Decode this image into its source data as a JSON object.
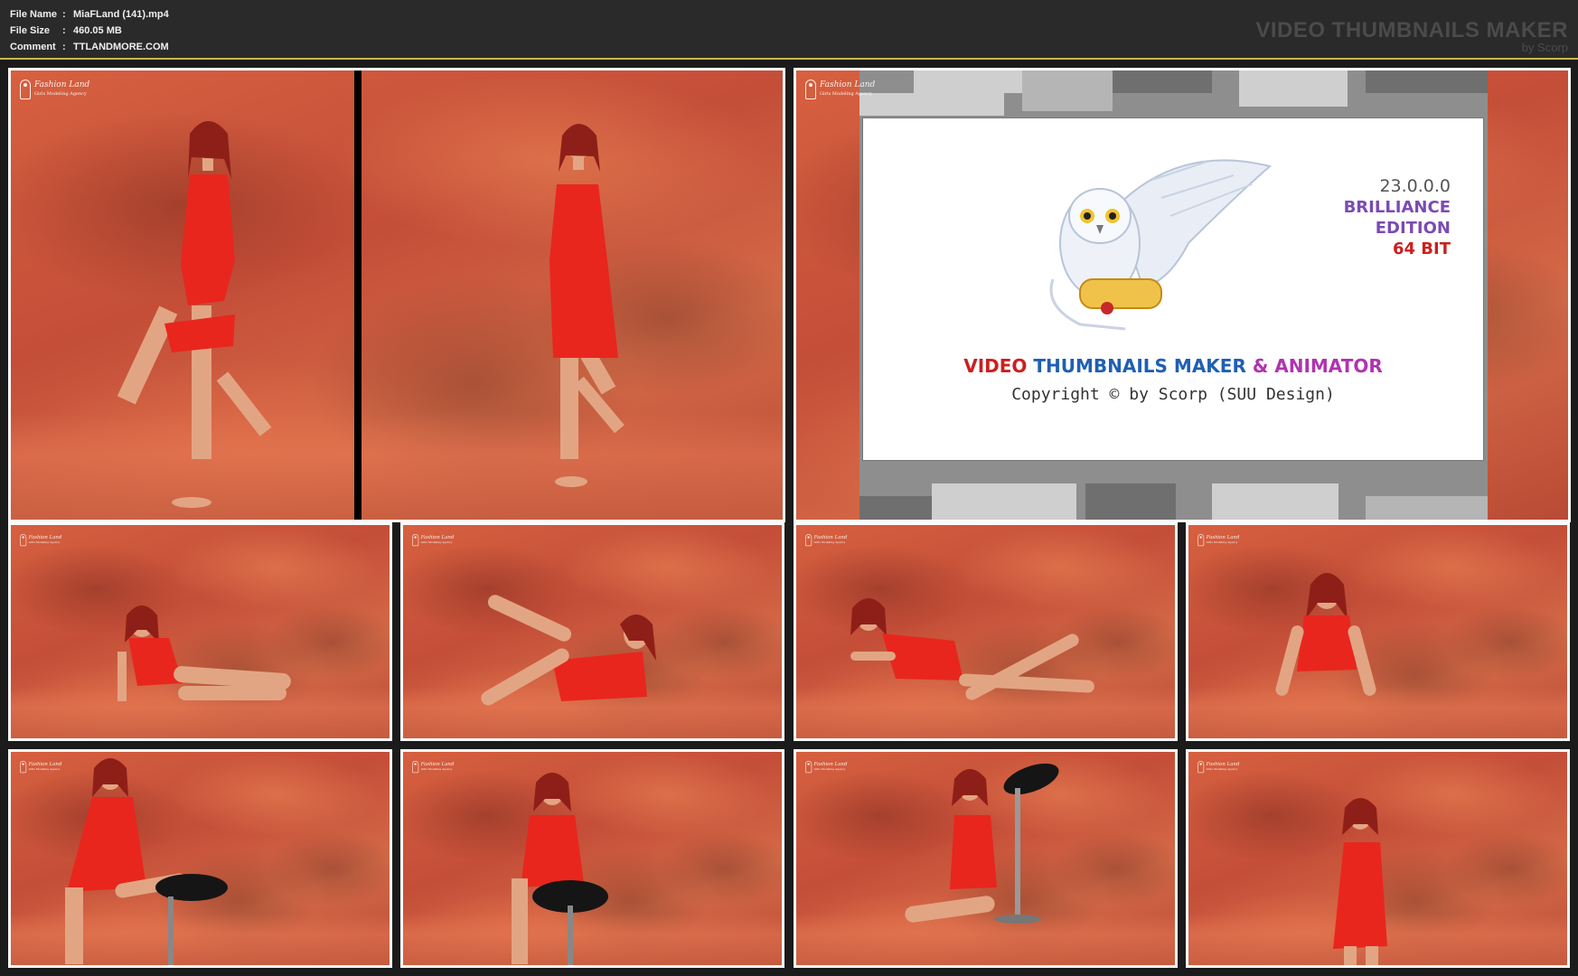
{
  "meta": {
    "rows": [
      {
        "key": "File Name",
        "sep": ":",
        "value": "MiaFLand (141).mp4"
      },
      {
        "key": "File Size",
        "sep": ":",
        "value": "460.05 MB"
      },
      {
        "key": "Comment",
        "sep": ":",
        "value": "TTLANDMORE.COM"
      }
    ]
  },
  "brand": {
    "title": "VIDEO THUMBNAILS MAKER",
    "subtitle": "by Scorp"
  },
  "splash": {
    "version": "23.0.0.0",
    "edition_line1": "BRILLIANCE",
    "edition_line2": "EDITION",
    "bits": "64 BIT",
    "product_part1": "VIDEO ",
    "product_part2": "THUMBNAILS MAKER ",
    "product_part3": "& ANIMATOR",
    "copyright": "Copyright © by Scorp (SUU Design)"
  },
  "logo": {
    "line1": "Fashion Land",
    "line2": "Girls Modeling Agency"
  },
  "colors": {
    "header_bg": "#2a2a2a",
    "header_border": "#c9b84a",
    "sheet_bg": "#1b1b1b",
    "backdrop": "#c9533d",
    "edition": "#7b4bb3",
    "bits": "#cc1f1f"
  }
}
